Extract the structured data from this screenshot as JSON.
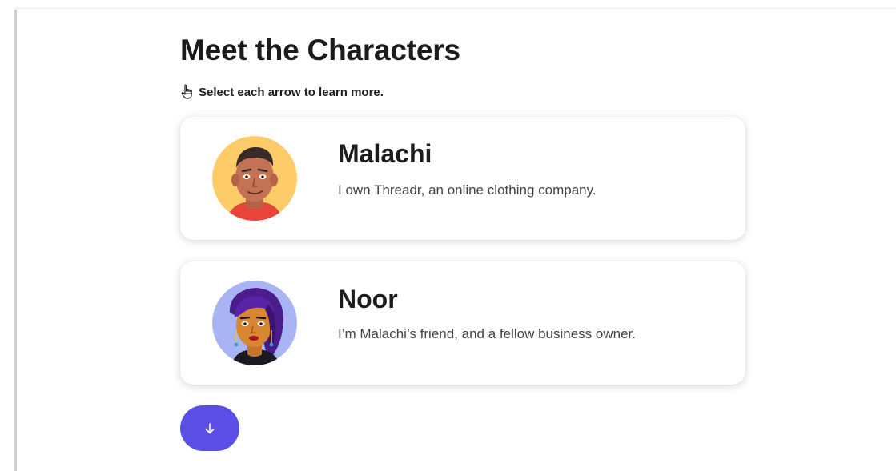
{
  "page": {
    "title": "Meet the Characters",
    "instruction": "Select each arrow to learn more."
  },
  "characters": [
    {
      "name": "Malachi",
      "description": "I own Threadr, an online clothing company.",
      "avatar_bg": "#fdcb68",
      "avatar_icon": "malachi-avatar"
    },
    {
      "name": "Noor",
      "description": "I’m Malachi’s friend, and a fellow business owner.",
      "avatar_bg": "#a9b4f5",
      "avatar_icon": "noor-avatar"
    }
  ],
  "continue_button": {
    "icon": "arrow-down-icon",
    "color": "#5a4ee6"
  }
}
